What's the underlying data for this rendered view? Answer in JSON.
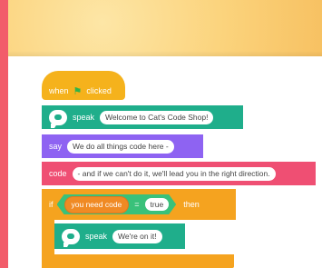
{
  "colors": {
    "border": "#f25c6a",
    "header": "#fbd37c",
    "event": "#f5b21c",
    "speak": "#1fae8b",
    "say": "#8e63f2",
    "code": "#ef4f73",
    "control": "#f5a31f",
    "operator": "#39c17a",
    "variable": "#f08a24"
  },
  "blocks": {
    "hat": {
      "when": "when",
      "flag_icon": "green-flag-icon",
      "clicked": "clicked"
    },
    "speak1": {
      "label": "speak",
      "text": "Welcome to Cat's Code Shop!",
      "icon": "speech-bubble-icon"
    },
    "say": {
      "label": "say",
      "text": "We do all things code here -"
    },
    "code": {
      "label": "code",
      "text": "- and if we can't do it, we'll lead you in the right direction."
    },
    "if": {
      "label": "if",
      "variable": "you need code",
      "operator": "=",
      "value": "true",
      "then": "then"
    },
    "speak2": {
      "label": "speak",
      "text": "We're on it!",
      "icon": "speech-bubble-icon"
    }
  }
}
